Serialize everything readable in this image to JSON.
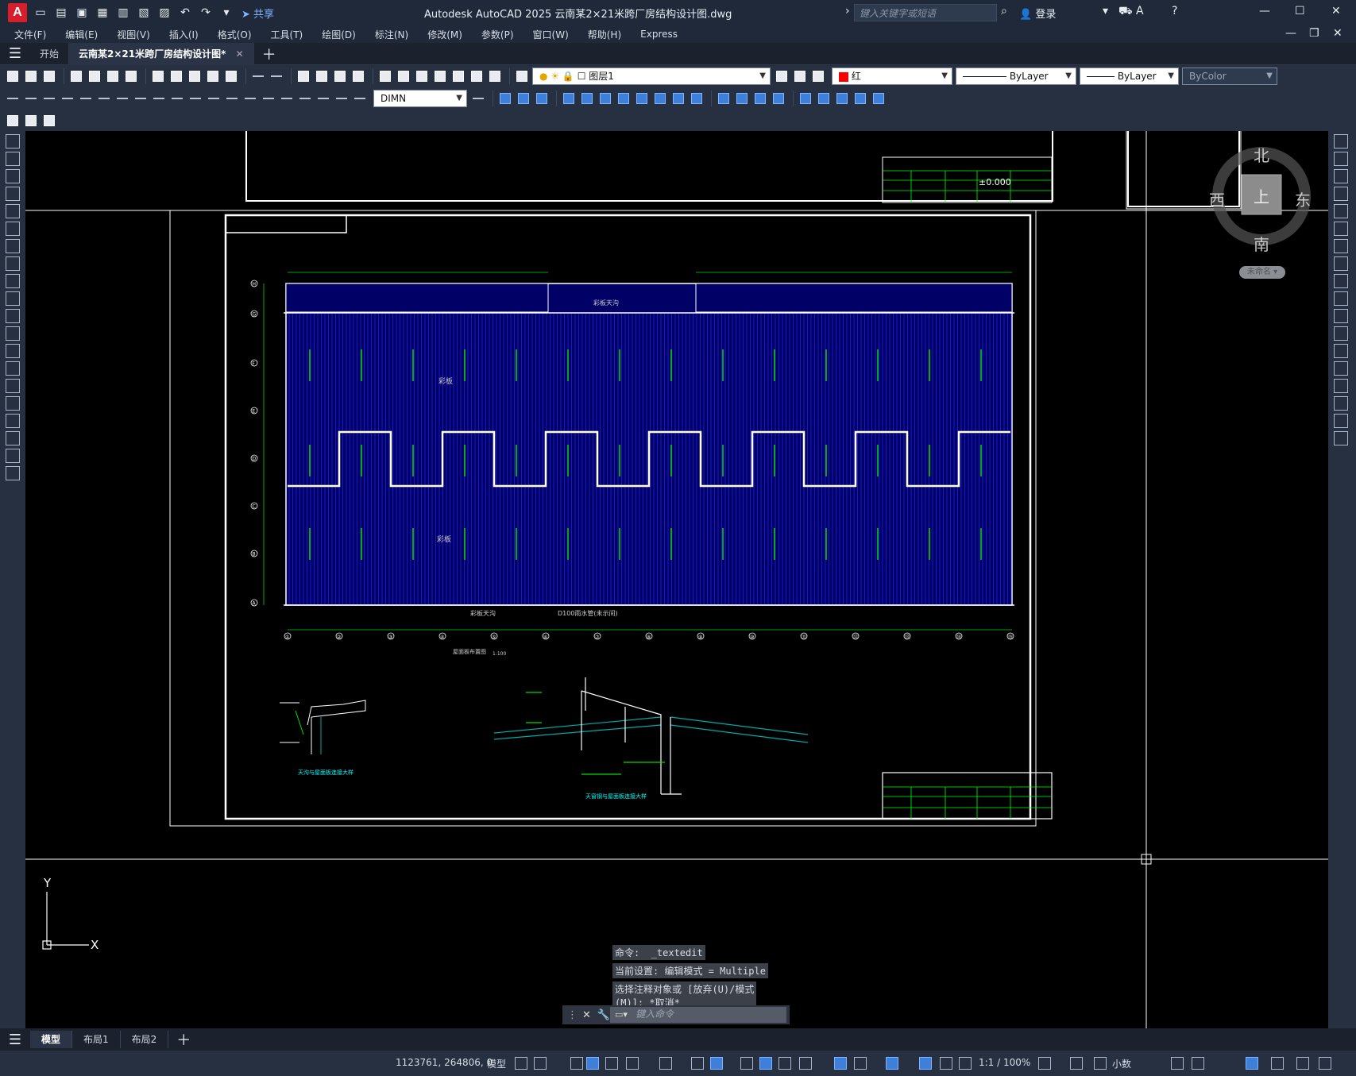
{
  "titlebar": {
    "app_letter": "A",
    "share_label": "共享",
    "title": "Autodesk AutoCAD 2025    云南某2×21米跨厂房结构设计图.dwg",
    "search_placeholder": "键入关键字或短语",
    "login_label": "登录"
  },
  "menus": [
    "文件(F)",
    "编辑(E)",
    "视图(V)",
    "插入(I)",
    "格式(O)",
    "工具(T)",
    "绘图(D)",
    "标注(N)",
    "修改(M)",
    "参数(P)",
    "窗口(W)",
    "帮助(H)",
    "Express"
  ],
  "tabs": {
    "start": "开始",
    "active": "云南某2×21米跨厂房结构设计图*"
  },
  "properties": {
    "layer": "图层1",
    "color": "红",
    "color_hex": "#ff0000",
    "linetype": "ByLayer",
    "lineweight": "ByLayer",
    "plotstyle": "ByColor",
    "dimstyle": "DIMN"
  },
  "viewcube": {
    "north": "北",
    "south": "南",
    "east": "东",
    "west": "西",
    "top": "上",
    "ucs_button": "未命名"
  },
  "drawing": {
    "title_block_value": "±0.000",
    "plan_title": "屋面板布置图",
    "plan_scale": "1:100",
    "label_roof_panel_1": "彩板",
    "label_roof_panel_2": "彩板",
    "label_skylight": "彩板天沟",
    "label_skylight_bottom": "彩板天沟",
    "label_downpipe": "D100雨水管(未示间)",
    "detail1_title": "天沟与屋面板连接大样",
    "detail2_title": "天窗钢与屋面板连接大样",
    "column_numbers": [
      "①",
      "②",
      "③",
      "④",
      "⑤",
      "⑥",
      "⑦",
      "⑧",
      "⑨",
      "⑩",
      "⑪",
      "⑫",
      "⑬",
      "⑭",
      "⑮"
    ],
    "row_letters": [
      "H",
      "G",
      "F",
      "E",
      "D",
      "C",
      "B",
      "A"
    ],
    "axis_x": "X",
    "axis_y": "Y"
  },
  "command": {
    "history": [
      "命令:  _textedit",
      "当前设置: 编辑模式 = Multiple",
      "选择注释对象或 [放弃(U)/模式\n(M)]: *取消*"
    ],
    "input_placeholder": "键入命令"
  },
  "layout_tabs": [
    "模型",
    "布局1",
    "布局2"
  ],
  "status": {
    "coordinates": "1123761, 264806, 0",
    "model": "模型",
    "scale": "1:1 / 100%",
    "units": "小数"
  }
}
